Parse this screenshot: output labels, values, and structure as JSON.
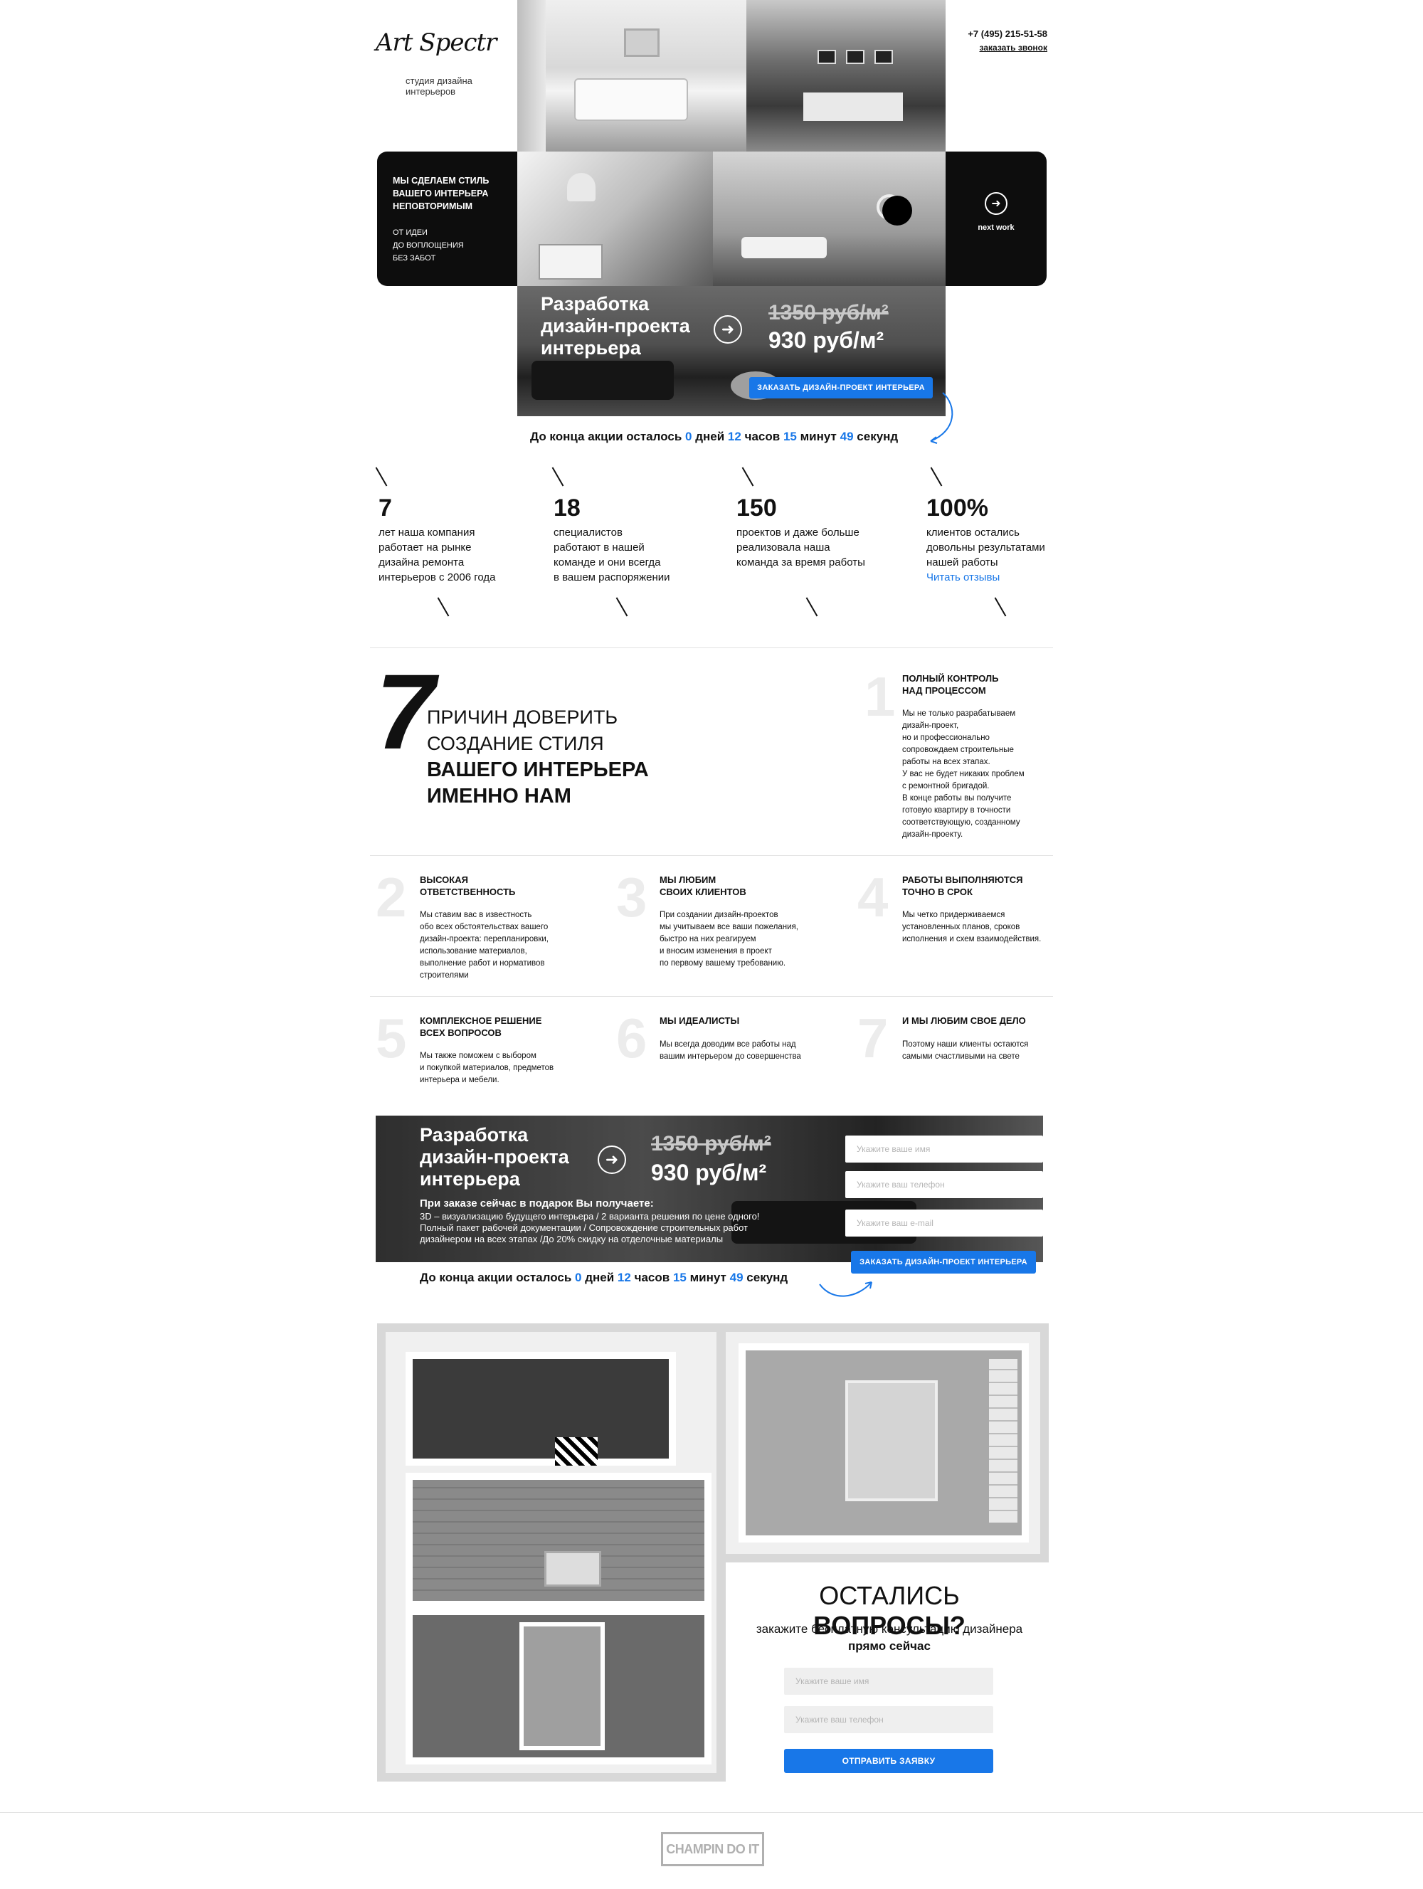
{
  "header": {
    "logo_text": "Art Spectr",
    "tagline_line1": "студия дизайна",
    "tagline_line2": "интерьеров",
    "phone": "+7 (495) 215-51-58",
    "callback_link": "заказать звонок"
  },
  "hero": {
    "slogan_lines": [
      "МЫ СДЕЛАЕМ СТИЛЬ",
      "ВАШЕГО ИНТЕРЬЕРА",
      "НЕПОВТОРИМЫМ"
    ],
    "sub_lines": [
      "ОТ ИДЕИ",
      "ДО ВОПЛОЩЕНИЯ",
      "БЕЗ ЗАБОТ"
    ],
    "next_work_label": "next work"
  },
  "offer": {
    "title_lines": [
      "Разработка",
      "дизайн-проекта",
      "интерьера"
    ],
    "old_price": "1350 руб/м²",
    "new_price": "930 руб/м²",
    "button": "ЗАКАЗАТЬ ДИЗАЙН-ПРОЕКТ ИНТЕРЬЕРА"
  },
  "countdown": {
    "prefix": "До конца акции осталось",
    "days": "0",
    "days_label": "дней",
    "hours": "12",
    "hours_label": "часов",
    "minutes": "15",
    "minutes_label": "минут",
    "seconds": "49",
    "seconds_label": "секунд"
  },
  "stats": [
    {
      "number": "7",
      "lines": [
        "лет наша компания",
        "работает на рынке",
        "дизайна ремонта",
        "интерьеров с 2006 года"
      ]
    },
    {
      "number": "18",
      "lines": [
        "специалистов",
        "работают в нашей",
        "команде и они всегда",
        "в вашем распоряжении"
      ]
    },
    {
      "number": "150",
      "lines": [
        "проектов и даже больше",
        "реализовала наша",
        "команда за время работы"
      ]
    },
    {
      "number": "100%",
      "lines": [
        "клиентов остались",
        "довольны результатами",
        "нашей работы"
      ],
      "link": "Читать отзывы"
    }
  ],
  "reasons_heading": {
    "number": "7",
    "line1": "ПРИЧИН ДОВЕРИТЬ",
    "line2": "СОЗДАНИЕ СТИЛЯ",
    "line3": "ВАШЕГО ИНТЕРЬЕРА",
    "line4": "ИМЕННО НАМ"
  },
  "reasons": [
    {
      "n": "1",
      "title": "ПОЛНЫЙ КОНТРОЛЬ\nНАД ПРОЦЕССОМ",
      "text": "Мы не только разрабатываем\nдизайн-проект,\nно и профессионально\nсопровождаем строительные\nработы на всех этапах.\nУ вас не будет никаких проблем\nс ремонтной бригадой.\nВ конце работы вы получите\nготовую квартиру в точности\nсоответствующую, созданному\nдизайн-проекту."
    },
    {
      "n": "2",
      "title": "ВЫСОКАЯ\nОТВЕТСТВЕННОСТЬ",
      "text": "Мы ставим вас в известность\nобо всех обстоятельствах вашего\nдизайн-проекта: перепланировки,\nиспользование материалов,\nвыполнение работ и нормативов\nстроителями"
    },
    {
      "n": "3",
      "title": "МЫ ЛЮБИМ\nСВОИХ КЛИЕНТОВ",
      "text": "При создании дизайн-проектов\nмы учитываем все ваши пожелания,\nбыстро на них реагируем\nи вносим изменения в проект\n по первому вашему требованию."
    },
    {
      "n": "4",
      "title": "РАБОТЫ ВЫПОЛНЯЮТСЯ\nТОЧНО В СРОК",
      "text": "Мы четко придерживаемся\nустановленных планов, сроков\nисполнения и схем взаимодействия."
    },
    {
      "n": "5",
      "title": "КОМПЛЕКСНОЕ РЕШЕНИЕ\nВСЕХ ВОПРОСОВ",
      "text": "Мы также поможем с выбором\nи покупкой материалов, предметов\nинтерьера и мебели."
    },
    {
      "n": "6",
      "title": "МЫ ИДЕАЛИСТЫ",
      "text": "Мы всегда доводим все работы над\nвашим интерьером до совершенства"
    },
    {
      "n": "7",
      "title": "И МЫ ЛЮБИМ СВОЕ ДЕЛО",
      "text": "Поэтому наши клиенты остаются\nсамыми счастливыми на свете"
    }
  ],
  "offer2": {
    "gift_title": "При заказе сейчас в подарок Вы получаете:",
    "gift_lines": [
      "3D – визуализацию будущего интерьера / 2 варианта решения по цене одного!",
      "Полный пакет рабочей документации / Сопровождение строительных работ",
      "дизайнером на всех этапах /До 20% скидку на отделочные материалы"
    ],
    "name_placeholder": "Укажите ваше имя",
    "phone_placeholder": "Укажите ваш телефон",
    "email_placeholder": "Укажите ваш e-mail",
    "button": "ЗАКАЗАТЬ ДИЗАЙН-ПРОЕКТ ИНТЕРЬЕРА"
  },
  "questions": {
    "title_light": "ОСТАЛИСЬ",
    "title_bold": "ВОПРОСЫ?",
    "sub": "закажите бесплатную консультацию дизайнера",
    "sub_bold": "прямо сейчас",
    "name_placeholder": "Укажите ваше имя",
    "phone_placeholder": "Укажите ваш телефон",
    "button": "ОТПРАВИТЬ ЗАЯВКУ"
  },
  "footer": {
    "credit": "CHAMPIN DO IT"
  },
  "colors": {
    "accent": "#1877e8",
    "dark": "#0d0d0d"
  }
}
